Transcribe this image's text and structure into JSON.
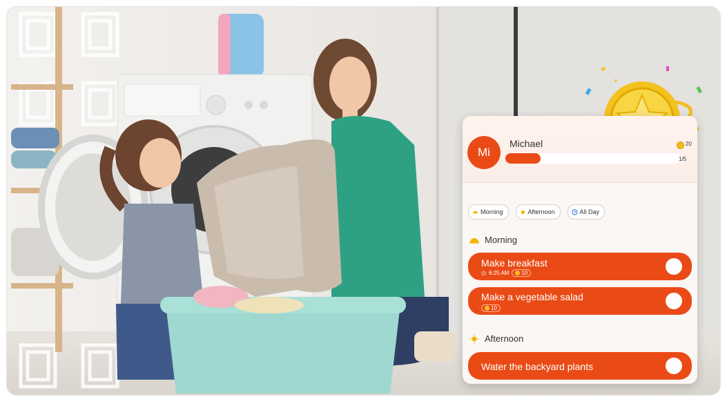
{
  "user": {
    "initials": "Mi",
    "name": "Michael",
    "points": "20",
    "progress_text": "1/5",
    "progress_fraction": 0.2
  },
  "filters": [
    {
      "label": "Morning",
      "icon": "sunrise-icon"
    },
    {
      "label": "Afternoon",
      "icon": "sun-icon"
    },
    {
      "label": "All Day",
      "icon": "clock-icon"
    }
  ],
  "sections": {
    "morning": {
      "title": "Morning",
      "tasks": [
        {
          "title": "Make breakfast",
          "time": "6:25 AM",
          "points": "10"
        },
        {
          "title": "Make a vegetable salad",
          "points": "10"
        }
      ]
    },
    "afternoon": {
      "title": "Afternoon",
      "tasks": [
        {
          "title": "Water the backyard plants"
        }
      ]
    }
  },
  "colors": {
    "accent": "#ea4b16",
    "card_bg": "#faf7f5",
    "coin": "#f2bb1c"
  }
}
